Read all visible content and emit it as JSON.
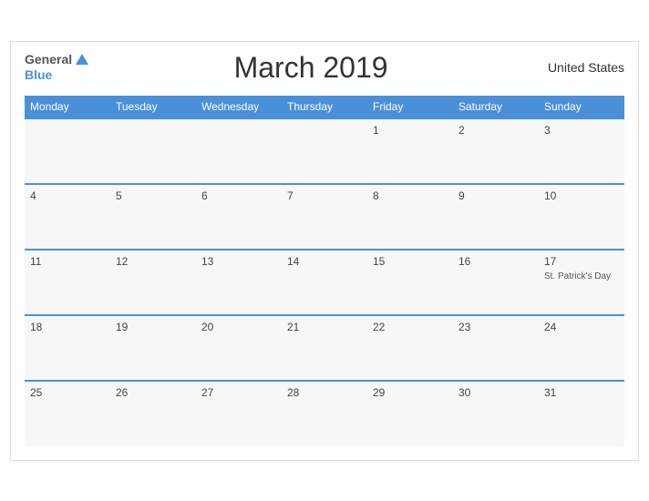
{
  "header": {
    "logo_general": "General",
    "logo_blue": "Blue",
    "title": "March 2019",
    "country": "United States"
  },
  "weekdays": [
    "Monday",
    "Tuesday",
    "Wednesday",
    "Thursday",
    "Friday",
    "Saturday",
    "Sunday"
  ],
  "weeks": [
    [
      {
        "day": "",
        "empty": true
      },
      {
        "day": "",
        "empty": true
      },
      {
        "day": "",
        "empty": true
      },
      {
        "day": "",
        "empty": true
      },
      {
        "day": "1",
        "empty": false,
        "event": ""
      },
      {
        "day": "2",
        "empty": false,
        "event": ""
      },
      {
        "day": "3",
        "empty": false,
        "event": ""
      }
    ],
    [
      {
        "day": "4",
        "empty": false,
        "event": ""
      },
      {
        "day": "5",
        "empty": false,
        "event": ""
      },
      {
        "day": "6",
        "empty": false,
        "event": ""
      },
      {
        "day": "7",
        "empty": false,
        "event": ""
      },
      {
        "day": "8",
        "empty": false,
        "event": ""
      },
      {
        "day": "9",
        "empty": false,
        "event": ""
      },
      {
        "day": "10",
        "empty": false,
        "event": ""
      }
    ],
    [
      {
        "day": "11",
        "empty": false,
        "event": ""
      },
      {
        "day": "12",
        "empty": false,
        "event": ""
      },
      {
        "day": "13",
        "empty": false,
        "event": ""
      },
      {
        "day": "14",
        "empty": false,
        "event": ""
      },
      {
        "day": "15",
        "empty": false,
        "event": ""
      },
      {
        "day": "16",
        "empty": false,
        "event": ""
      },
      {
        "day": "17",
        "empty": false,
        "event": "St. Patrick's Day"
      }
    ],
    [
      {
        "day": "18",
        "empty": false,
        "event": ""
      },
      {
        "day": "19",
        "empty": false,
        "event": ""
      },
      {
        "day": "20",
        "empty": false,
        "event": ""
      },
      {
        "day": "21",
        "empty": false,
        "event": ""
      },
      {
        "day": "22",
        "empty": false,
        "event": ""
      },
      {
        "day": "23",
        "empty": false,
        "event": ""
      },
      {
        "day": "24",
        "empty": false,
        "event": ""
      }
    ],
    [
      {
        "day": "25",
        "empty": false,
        "event": ""
      },
      {
        "day": "26",
        "empty": false,
        "event": ""
      },
      {
        "day": "27",
        "empty": false,
        "event": ""
      },
      {
        "day": "28",
        "empty": false,
        "event": ""
      },
      {
        "day": "29",
        "empty": false,
        "event": ""
      },
      {
        "day": "30",
        "empty": false,
        "event": ""
      },
      {
        "day": "31",
        "empty": false,
        "event": ""
      }
    ]
  ]
}
